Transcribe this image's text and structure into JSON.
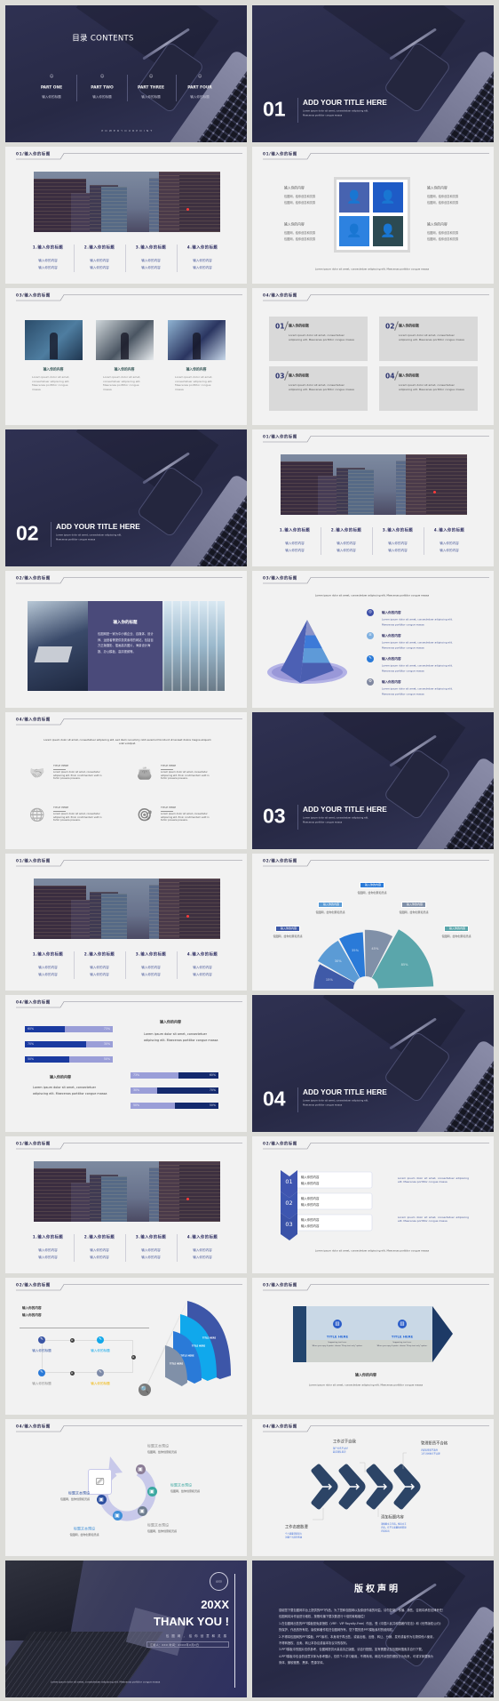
{
  "page": {
    "background": "#dcdcd8",
    "slide_light": "#f2f2f2",
    "slide_dark": "#2b2d4b",
    "accent": "#3b4a8c"
  },
  "common": {
    "lorem": "Lorem ipsum dolor sit amet, consectetuer adipiscing elit. Maecenas porttitor congue massa",
    "lorem_a": "Lorem ipsum dolor sit amet, consectetuer adipiscing elit.",
    "lorem_b": "Maecenas porttitor congue massa",
    "input_title": "输入你的标题",
    "input_content": "输入你的内容",
    "slogan": "包图网，给你创意和灵感"
  },
  "slides": [
    {
      "type": "cover",
      "title": "目录  CONTENTS",
      "footer": "P O W E R     Y O U R     P O I N T",
      "parts": [
        {
          "label": "PART ONE",
          "sub": "输入你的标题"
        },
        {
          "label": "PART TWO",
          "sub": "输入你的标题"
        },
        {
          "label": "PART THREE",
          "sub": "输入你的标题"
        },
        {
          "label": "PART FOUR",
          "sub": "输入你的标题"
        }
      ]
    },
    {
      "type": "section",
      "number": "01",
      "title": "ADD YOUR TITLE HERE"
    },
    {
      "type": "city4",
      "header": "01/输入你的标题",
      "columns": [
        {
          "title": "1.输入你的标题"
        },
        {
          "title": "2.输入你的标题"
        },
        {
          "title": "3.输入你的标题"
        },
        {
          "title": "4.输入你的标题"
        }
      ]
    },
    {
      "type": "icongrid",
      "header": "01/输入你的标题",
      "tile_colors": [
        "#4763b0",
        "#1e5bc6",
        "#2d82e0",
        "#2c4a52"
      ]
    },
    {
      "type": "photos3",
      "header": "03/输入你的标题"
    },
    {
      "type": "boxes4",
      "header": "04/输入你的标题",
      "boxes": [
        {
          "num": "01"
        },
        {
          "num": "02"
        },
        {
          "num": "03"
        },
        {
          "num": "04"
        }
      ]
    },
    {
      "type": "section",
      "number": "02",
      "title": "ADD YOUR TITLE HERE"
    },
    {
      "type": "city4",
      "header": "01/输入你的标题",
      "columns": [
        {
          "title": "1.输入你的标题"
        },
        {
          "title": "2.输入你的标题"
        },
        {
          "title": "3.输入你的标题"
        },
        {
          "title": "4.输入你的标题"
        }
      ]
    },
    {
      "type": "panel",
      "header": "02/输入你的标题",
      "title": "输入你的标题",
      "text": "包图网是一家为中小微企业、自媒体、设计师、运营者等提供务类素材的网站，包括百万正版摄影、插画高清图片，海量设计海报、办公模板、高清视频等。"
    },
    {
      "type": "pyramid",
      "header": "03/输入你的标题",
      "icon_colors": [
        "#3d4fa8",
        "#7fb0e0",
        "#2a7ad8",
        "#8088a0"
      ]
    },
    {
      "type": "icons4",
      "header": "04/输入你的标题",
      "intro": "Lorem ipsum dolor sit amet, consectetuer adipiscing elit, sed diam nonummy nibh euismod tincidunt ut laoreet dolore magna aliquam erat volutpat.",
      "items": [
        {
          "icon": "handshake-icon",
          "title": "TITLE HERE",
          "text": "Lorem ipsum dolor sit amet, consectetur adipiscing elit. Proin condimentum velit in tortor posuere posuere."
        },
        {
          "icon": "wallet-icon",
          "title": "TITLE HERE",
          "text": "Lorem ipsum dolor sit amet, consectetur adipiscing elit. Proin condimentum velit in tortor posuere posuere."
        },
        {
          "icon": "globe-shield-icon",
          "title": "TITLE HERE",
          "text": "Lorem ipsum dolor sit amet, consectetur adipiscing elit. Proin condimentum velit in tortor posuere posuere."
        },
        {
          "icon": "target-icon",
          "title": "TITLE HERE",
          "text": "Lorem ipsum dolor sit amet, consectetur adipiscing elit. Proin condimentum velit in tortor posuere posuere."
        }
      ]
    },
    {
      "type": "section",
      "number": "03",
      "title": "ADD YOUR TITLE HERE"
    },
    {
      "type": "city4",
      "header": "01/输入你的标题",
      "columns": [
        {
          "title": "1.输入你的标题"
        },
        {
          "title": "2.输入你的标题"
        },
        {
          "title": "3.输入你的标题"
        },
        {
          "title": "4.输入你的标题"
        }
      ]
    },
    {
      "type": "halfdonut",
      "header": "02/输入你的标题",
      "segments": [
        {
          "value": "15%",
          "color": "#3f5aa8"
        },
        {
          "value": "30%",
          "color": "#5b9bd5"
        },
        {
          "value": "35%",
          "color": "#2a7ad8"
        },
        {
          "value": "45%",
          "color": "#8090a8"
        },
        {
          "value": "85%",
          "color": "#5aa6ab"
        }
      ]
    },
    {
      "type": "bars",
      "header": "04/输入你的标题",
      "left_bars": [
        {
          "a": "60%",
          "b": "73%"
        },
        {
          "a": "70%",
          "b": "30%"
        },
        {
          "a": "50%",
          "b": "50%"
        }
      ],
      "right_bars": [
        {
          "a": "73%",
          "b": "60%"
        },
        {
          "a": "30%",
          "b": "70%"
        },
        {
          "a": "50%",
          "b": "50%"
        }
      ]
    },
    {
      "type": "section",
      "number": "04",
      "title": "ADD YOUR TITLE HERE"
    },
    {
      "type": "city4",
      "header": "01/输入你的标题",
      "columns": [
        {
          "title": "1.输入你的标题"
        },
        {
          "title": "2.输入你的标题"
        },
        {
          "title": "3.输入你的标题"
        },
        {
          "title": "4.输入你的标题"
        }
      ]
    },
    {
      "type": "chevlist",
      "header": "02/输入你的标题",
      "items": [
        {
          "num": "01"
        },
        {
          "num": "02"
        },
        {
          "num": "03"
        }
      ]
    },
    {
      "type": "fan",
      "header": "02/输入你的标题",
      "nodes": [
        {
          "color": "#3a55a5",
          "label_color": "#3a5aa5"
        },
        {
          "color": "#12a8ea",
          "label_color": "#12a8ea"
        },
        {
          "color": "#2a7ad8",
          "label_color": "#8a8a8a"
        },
        {
          "color": "#7d8aa8",
          "label_color": "#f0b400"
        }
      ],
      "wedges": [
        {
          "label": "TITLE HERE",
          "color": "#8090a8"
        },
        {
          "label": "TITLE HERE",
          "color": "#2a7ad8"
        },
        {
          "label": "TITLE HERE",
          "color": "#10a8ec"
        },
        {
          "label": "TITLE HERE",
          "color": "#3d56a8"
        }
      ]
    },
    {
      "type": "banner",
      "header": "03/输入你的标题",
      "cards": [
        {
          "title": "TITLE HERE",
          "line1": "Supporting text here.",
          "line2": "When you copy & paste, choose \"Keep text only\" option."
        },
        {
          "title": "TITLE HERE",
          "line1": "Supporting text here.",
          "line2": "When you copy & paste, choose \"Keep text only\" option."
        }
      ]
    },
    {
      "type": "cycle",
      "header": "04/输入你的标题",
      "label": "标题文本预设",
      "dot_colors": [
        "#8b7d96",
        "#3aa8a0",
        "#6e7d90",
        "#3f8fd8",
        "#2c4fa0"
      ]
    },
    {
      "type": "process",
      "header": "04/输入你的标题",
      "steps": [
        {
          "title": "工作过于自我",
          "lines": [
            "客户关系不太好",
            "缺乏团队意识"
          ]
        },
        {
          "title": "管理职责不合格",
          "lines": [
            "内部反馈较不及时",
            "工作计划执行不合理"
          ]
        },
        {
          "title": "添加标题内容",
          "lines": [
            "请根据文字内容，框出文字",
            "内容，在不让面重新按照原",
            "内容标出"
          ]
        },
        {
          "title": "工作态度散漫",
          "lines": [
            "个人能量消耗较大",
            "注重于当前的利益"
          ]
        }
      ]
    },
    {
      "type": "thanks",
      "logo": "LOGO",
      "year": "20XX",
      "title": "THANK YOU !",
      "subtitle": "包 图 网 ， 给 你 创 意 和 灵 感",
      "info": "汇报人：XXX    时间：20XX年X月X日"
    },
    {
      "type": "copyright",
      "title": "版权声明",
      "paragraphs": [
        "感谢您下载包图网平台上提供的PPT作品，为了您和包图网以及原创作者的利益，请勿复制、传播、销售，否则将承担法律责任！",
        "包图网将对作品进行维权，按照传播下载次数进行十倍的索取赔偿！",
        "1.在包图网出售的PPT模板是免费授权（VRF：VIP Royalty-Free）作品，受《中国人民共和国著作权法》和《世界版权公约》",
        "的保护，作品的所有权、版权和著作权归包图网所有，您下载的是PPT模板素材的使用权。",
        "2.不得将包图网的PPT模板、PPT素材，本身用于再出售，或者出租、出借、转让、分销、发布或者作为礼物供他人使用，",
        "不得转授权、出卖、转让本协议或者本协议中的权利。",
        "3.PPT模板中的图片仅供参考，包图网提供大量高清正版图，请自行配图，如有需要请至包图网搜索并自行下载。",
        "4.PPT模板中包含的创意字体为参考展示，仅供个人学习使用，不得商用，网站不对您的侵权行为负责，可将字体替换为",
        "宋体、微软雅黑、黑体、思源字体。"
      ]
    }
  ]
}
